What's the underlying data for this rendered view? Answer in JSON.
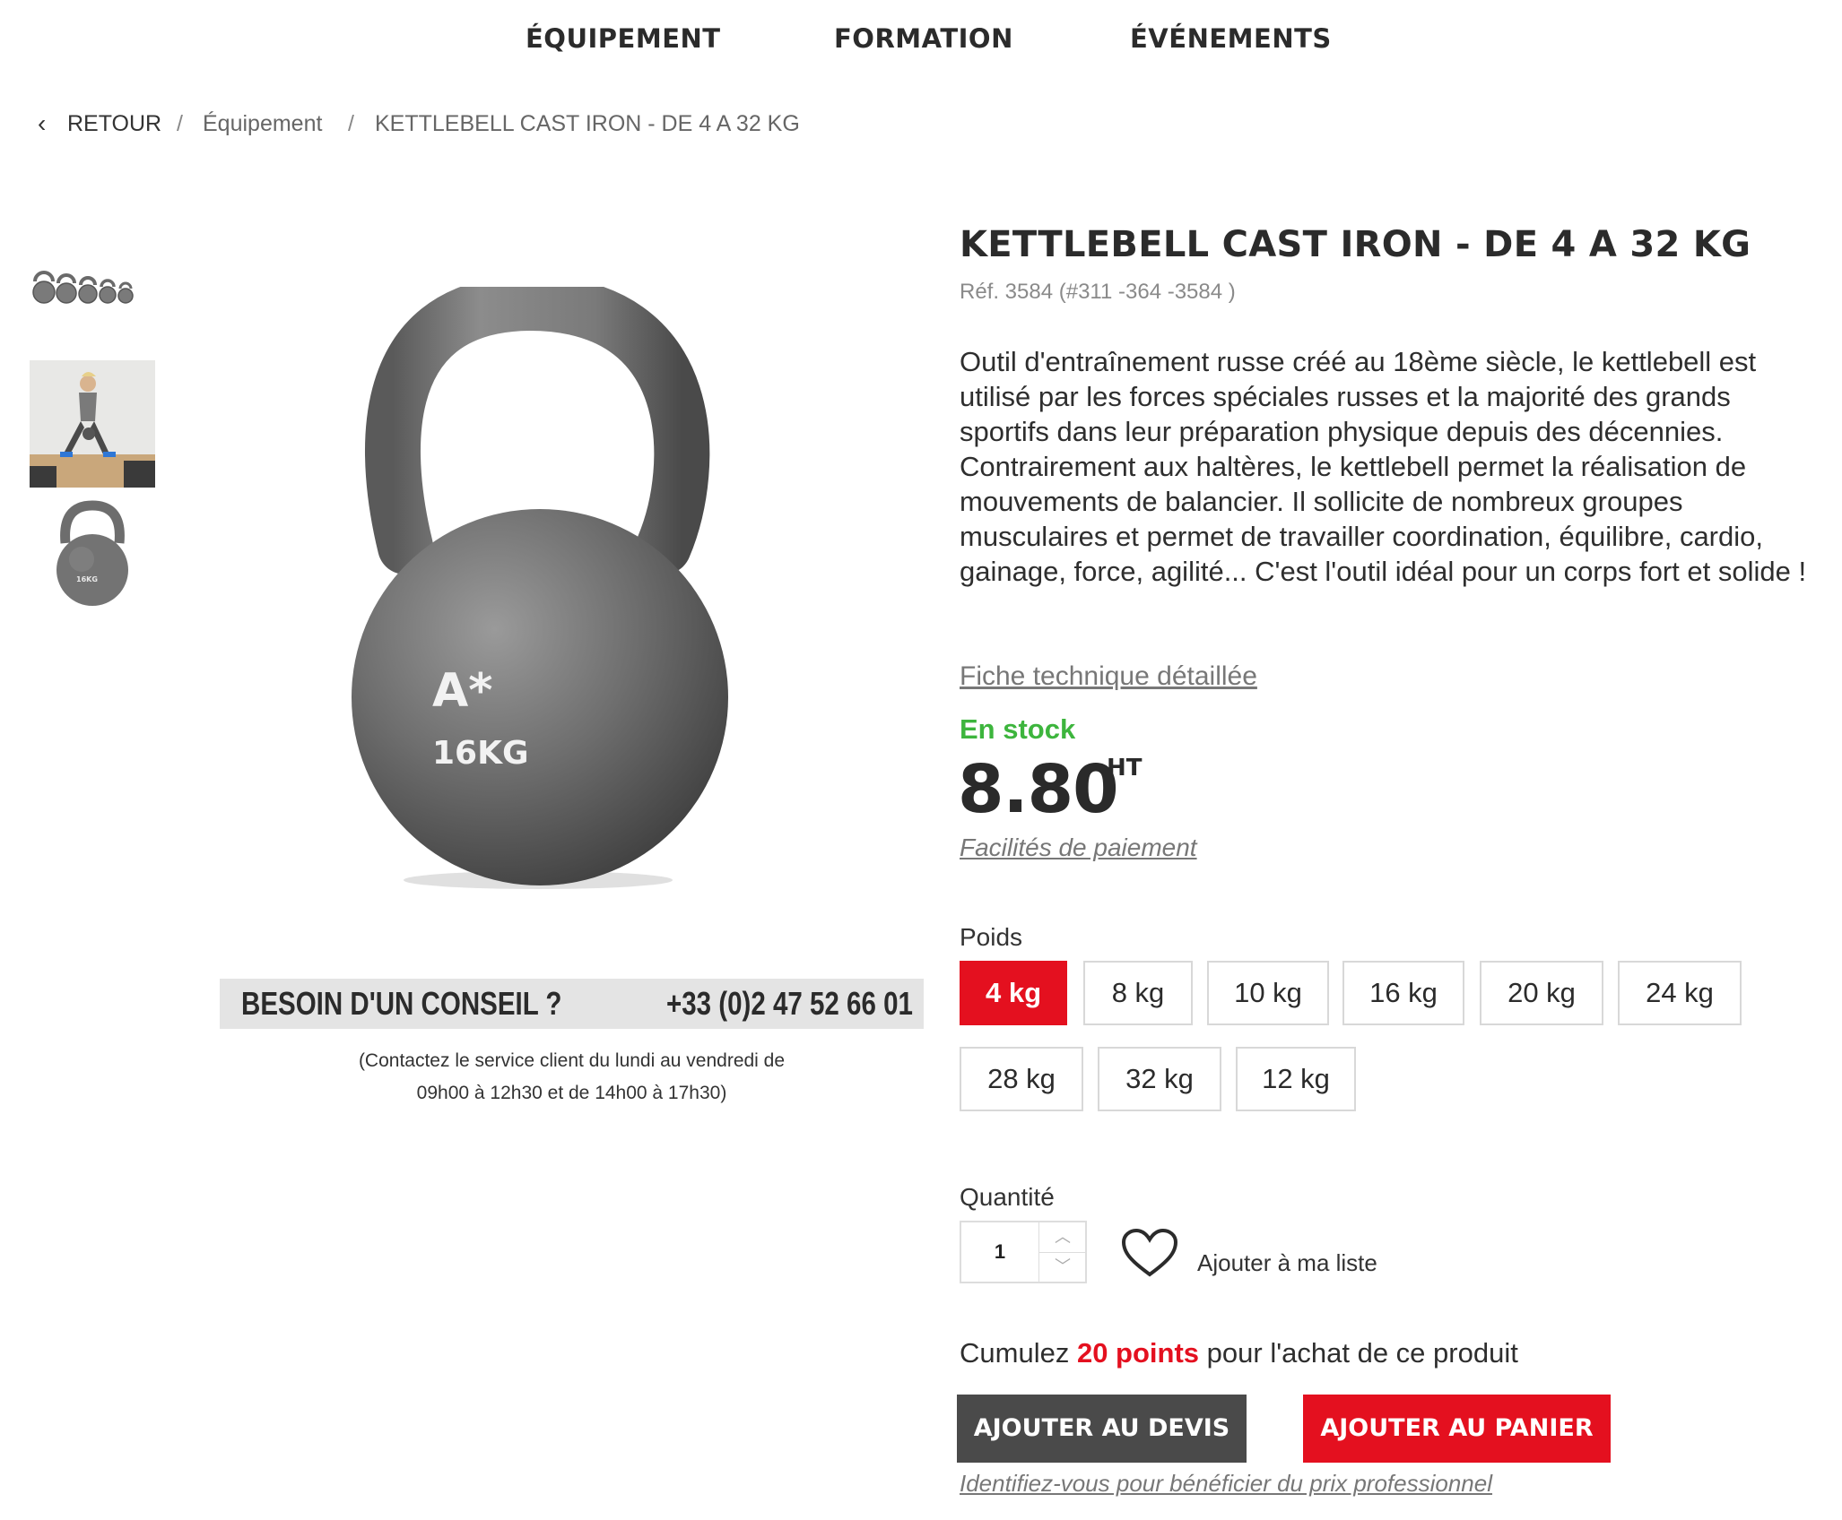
{
  "nav": {
    "items": [
      "ÉQUIPEMENT",
      "FORMATION",
      "ÉVÉNEMENTS"
    ]
  },
  "breadcrumb": {
    "back_icon": "‹",
    "back": "RETOUR",
    "separator": "/",
    "category": "Équipement",
    "current": "KETTLEBELL CAST IRON - DE 4 A 32 KG"
  },
  "product": {
    "title": "KETTLEBELL CAST IRON - DE 4 A 32 KG",
    "ref": "Réf. 3584 (#311 -364 -3584 )",
    "description": "Outil d'entraînement russe créé au 18ème siècle, le kettlebell est utilisé par les forces spéciales russes et la majorité des grands sportifs dans leur préparation physique depuis des décennies. Contrairement aux haltères, le kettlebell permet la réalisation de mouvements de balancier. Il sollicite de nombreux groupes musculaires et permet de travailler coordination, équilibre, cardio, gainage, force, agilité... C'est l'outil idéal pour un corps fort et solide !",
    "image_label_brand": "A*",
    "image_label_weight": "16KG",
    "thumb_label_weight": "16KG",
    "fiche_link": "Fiche technique détaillée",
    "stock": "En stock",
    "price": "8.80",
    "price_suffix": "HT",
    "payment_link": "Facilités de paiement"
  },
  "weights": {
    "label": "Poids",
    "selected": "4 kg",
    "options": [
      "4 kg",
      "8 kg",
      "10 kg",
      "16 kg",
      "20 kg",
      "24 kg",
      "28 kg",
      "32 kg",
      "12 kg"
    ]
  },
  "conseil": {
    "title": "BESOIN D'UN CONSEIL ?",
    "phone": "+33 (0)2 47 52 66 01",
    "note_line1": "(Contactez le service client du lundi au vendredi de",
    "note_line2": "09h00 à 12h30 et de 14h00 à 17h30)"
  },
  "quantity": {
    "label": "Quantité",
    "value": "1",
    "up_icon": "︿",
    "down_icon": "﹀"
  },
  "wishlist": {
    "label": "Ajouter à ma liste",
    "icon": "heart-outline-icon"
  },
  "points": {
    "prefix": "Cumulez",
    "value": "20 points",
    "suffix": "pour l'achat de ce produit"
  },
  "actions": {
    "quote": "AJOUTER AU DEVIS",
    "cart": "AJOUTER AU PANIER",
    "login_note": "Identifiez-vous pour bénéficier du prix professionnel"
  },
  "colors": {
    "accent_red": "#e4101f",
    "stock_green": "#3db53d",
    "dark_button": "#4a4a4a"
  }
}
